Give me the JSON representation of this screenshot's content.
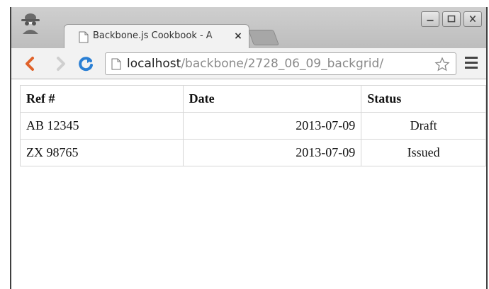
{
  "browser": {
    "tab_title": "Backbone.js Cookbook - A",
    "tab_close": "×",
    "url_host": "localhost",
    "url_path": "/backbone/2728_06_09_backgrid/",
    "accent_reload": "#2a7fd4",
    "accent_back": "#e0622a"
  },
  "grid": {
    "headers": [
      "Ref #",
      "Date",
      "Status"
    ],
    "rows": [
      {
        "ref": "AB 12345",
        "date": "2013-07-09",
        "status": "Draft"
      },
      {
        "ref": "ZX 98765",
        "date": "2013-07-09",
        "status": "Issued"
      }
    ]
  }
}
